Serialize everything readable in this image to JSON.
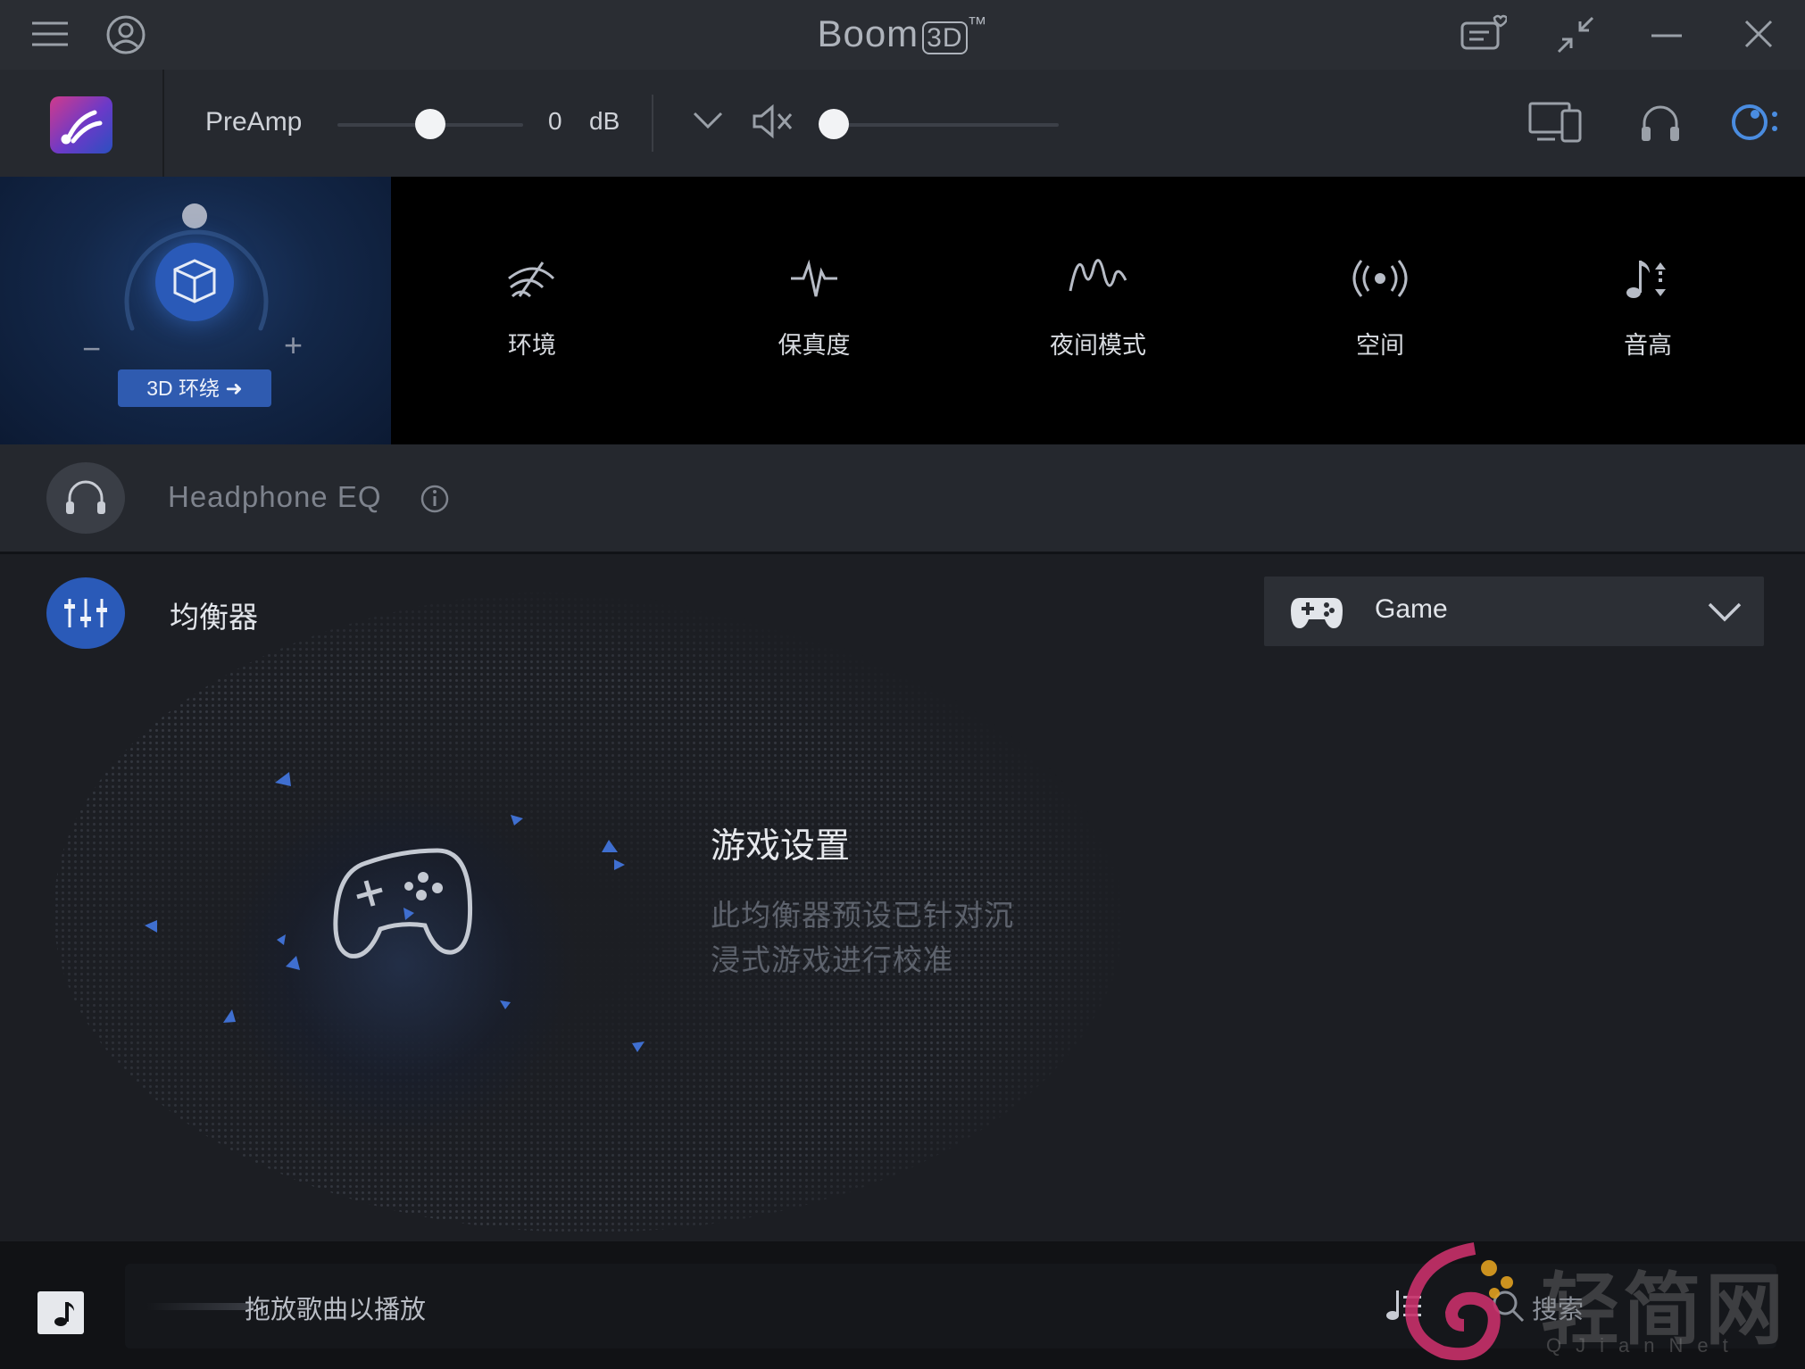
{
  "window": {
    "title": "Boom",
    "title_badge": "3D",
    "title_tm": "™"
  },
  "toolbar": {
    "preamp_label": "PreAmp",
    "preamp_value": "0",
    "preamp_unit": "dB",
    "preamp_level": 0.5,
    "volume_level": 0.02
  },
  "effects": {
    "surround_button": "3D 环绕 ➜",
    "items": [
      {
        "icon": "ambience-icon",
        "label": "环境"
      },
      {
        "icon": "fidelity-icon",
        "label": "保真度"
      },
      {
        "icon": "night-mode-icon",
        "label": "夜间模式"
      },
      {
        "icon": "spatial-icon",
        "label": "空间"
      },
      {
        "icon": "pitch-icon",
        "label": "音高"
      }
    ]
  },
  "headphone_eq": {
    "label": "Headphone EQ"
  },
  "equalizer": {
    "label": "均衡器",
    "preset": "Game",
    "info_title": "游戏设置",
    "info_line1": "此均衡器预设已针对沉",
    "info_line2": "浸式游戏进行校准"
  },
  "player": {
    "drop_hint": "拖放歌曲以播放",
    "search_label": "搜索"
  },
  "watermark": {
    "text": "轻简网",
    "sub": "QJianNet"
  },
  "colors": {
    "accent": "#2f5bb0",
    "knob_active": "#2a5ab8",
    "background": "#1b1d22"
  }
}
